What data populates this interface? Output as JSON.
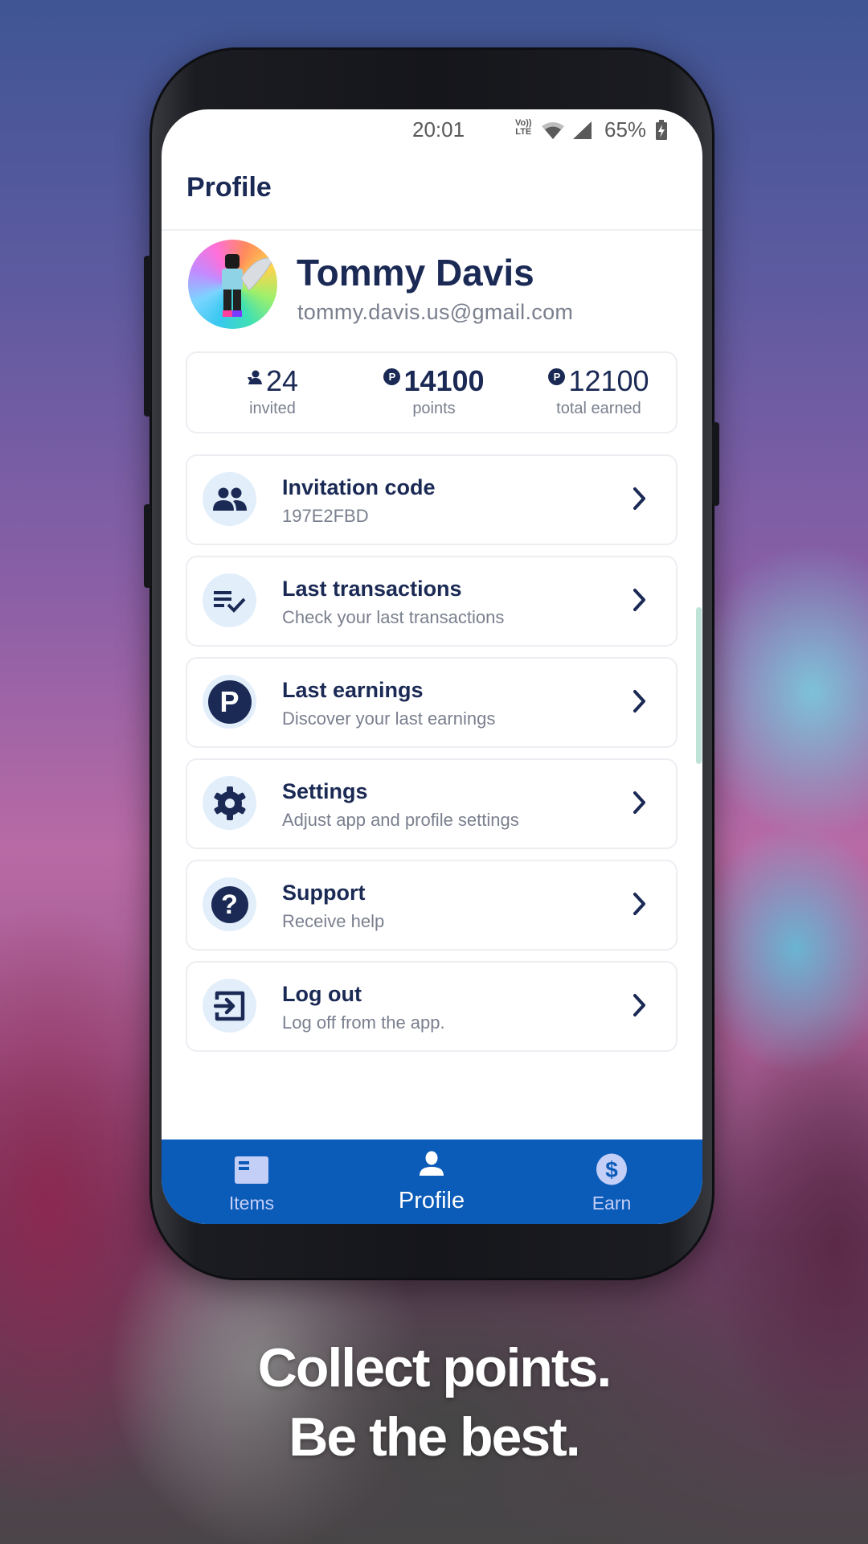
{
  "status_bar": {
    "time": "20:01",
    "network_top": "Vo))",
    "network_bottom": "LTE",
    "battery_percent": "65%",
    "icons": [
      "volte-icon",
      "wifi-icon",
      "signal-icon",
      "battery-charging-icon"
    ]
  },
  "header": {
    "title": "Profile"
  },
  "profile": {
    "name": "Tommy Davis",
    "email": "tommy.davis.us@gmail.com",
    "avatar_icon": "avatar-image"
  },
  "stats": [
    {
      "icon": "person-icon",
      "value": "24",
      "label": "invited"
    },
    {
      "icon": "points-coin-icon",
      "coin_glyph": "P",
      "value": "14100",
      "label": "points"
    },
    {
      "icon": "points-coin-icon",
      "coin_glyph": "P",
      "value": "12100",
      "label": "total earned"
    }
  ],
  "menu": [
    {
      "id": "invitation-code",
      "icon": "group-icon",
      "title": "Invitation code",
      "subtitle": "197E2FBD"
    },
    {
      "id": "last-transactions",
      "icon": "list-check-icon",
      "title": "Last transactions",
      "subtitle": "Check your last transactions"
    },
    {
      "id": "last-earnings",
      "icon": "points-coin-icon",
      "icon_glyph": "P",
      "title": "Last earnings",
      "subtitle": "Discover your last earnings"
    },
    {
      "id": "settings",
      "icon": "gear-icon",
      "title": "Settings",
      "subtitle": "Adjust app and profile settings"
    },
    {
      "id": "support",
      "icon": "help-circle-icon",
      "icon_glyph": "?",
      "title": "Support",
      "subtitle": "Receive help"
    },
    {
      "id": "log-out",
      "icon": "logout-icon",
      "title": "Log out",
      "subtitle": "Log off from the app."
    }
  ],
  "bottom_nav": {
    "items": [
      {
        "id": "items",
        "icon": "items-icon",
        "label": "Items",
        "active": false
      },
      {
        "id": "profile",
        "icon": "person-icon",
        "label": "Profile",
        "active": true
      },
      {
        "id": "earn",
        "icon": "dollar-circle-icon",
        "label": "Earn",
        "active": false
      }
    ]
  },
  "colors": {
    "primary_navy": "#1b2a55",
    "nav_blue": "#0b5bb8",
    "icon_bg": "#e3eefb",
    "muted_text": "#7a7f8e",
    "inactive_nav": "#c4cff8"
  },
  "tagline": {
    "line1": "Collect points.",
    "line2": "Be the best."
  }
}
